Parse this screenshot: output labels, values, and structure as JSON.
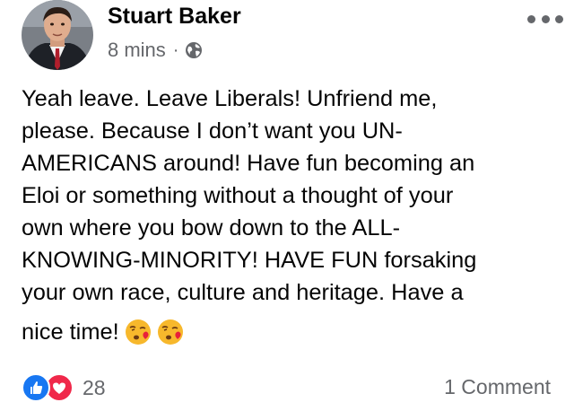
{
  "post": {
    "author": "Stuart Baker",
    "time": "8 mins",
    "separator": "·",
    "privacy_icon": "globe-icon",
    "more_icon": "more-options-icon",
    "body_lines": [
      "Yeah leave.  Leave Liberals!  Unfriend me,",
      "please.  Because I don’t want you UN-",
      "AMERICANS around!  Have fun becoming an",
      "Eloi or something without a thought of your",
      "own where you bow down to the ALL-",
      "KNOWING-MINORITY!  HAVE FUN forsaking",
      "your own race, culture and heritage.  Have a"
    ],
    "last_line": "nice time!",
    "emojis": [
      "face-blowing-a-kiss-emoji",
      "face-blowing-a-kiss-emoji"
    ]
  },
  "footer": {
    "reaction_icons": [
      "like-icon",
      "love-icon"
    ],
    "reaction_count": "28",
    "comments": "1 Comment"
  },
  "colors": {
    "like_blue": "#1877f2",
    "love_red": "#f0284a",
    "secondary_text": "#65676b",
    "primary_text": "#050505"
  }
}
